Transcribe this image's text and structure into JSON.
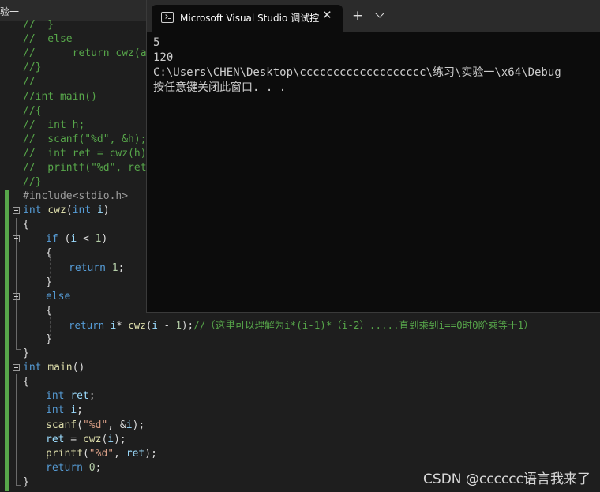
{
  "editor": {
    "tab_label": "验一",
    "code": {
      "c_if_close": "//  }",
      "c_else": "//  else",
      "c_return": "//      return cwz(a",
      "c_brace_close": "//}",
      "c_blank": "//",
      "c_main": "//int main()",
      "c_brace_open": "//{",
      "c_int_h": "//  int h;",
      "c_scanf": "//  scanf(\"%d\", &h);",
      "c_int_ret": "//  int ret = cwz(h);",
      "c_printf": "//  printf(\"%d\", ret)",
      "c_end": "//}",
      "include": "#include<stdio.h>",
      "kw_int": "int",
      "kw_if": "if",
      "kw_else": "else",
      "kw_return": "return",
      "fn_cwz": "cwz",
      "fn_main": "main",
      "fn_scanf": "scanf",
      "fn_printf": "printf",
      "var_i": "i",
      "var_ret": "ret",
      "num_0": "0",
      "num_1": "1",
      "str_fmt": "\"%d\"",
      "l14_paren": "(",
      "l14_close": ")",
      "brace_open": "{",
      "brace_close": "}",
      "l16_open": " (",
      "l16_op": " < ",
      "l16_close": ")",
      "semi": ";",
      "sp": " ",
      "l22_mid": "* ",
      "l22_paren": "(",
      "l22_op": " - ",
      "l22_close": ");",
      "l22_comment": "//（这里可以理解为i*(i-1)*（i-2）.....直到乘到i==0时0阶乘等于1）",
      "main_parens": "()",
      "l28_semi": ";",
      "l30_open": "(",
      "l30_mid": ", &",
      "l30_close": ");",
      "l31_assign": " = ",
      "l31_open": "(",
      "l31_close": ");",
      "l32_open": "(",
      "l32_comma": ", ",
      "l32_close": ");"
    }
  },
  "terminal": {
    "tab_title": "Microsoft Visual Studio 调试控",
    "close_glyph": "✕",
    "new_tab_glyph": "+",
    "output": [
      "5",
      "120",
      "C:\\Users\\CHEN\\Desktop\\ccccccccccccccccccc\\练习\\实验一\\x64\\Debug",
      "按任意键关闭此窗口. . ."
    ]
  },
  "watermark": "CSDN @cccccc语言我来了",
  "colors": {
    "editor_bg": "#1e1e1e",
    "terminal_bg": "#0c0c0c",
    "keyword": "#569cd6",
    "comment": "#57a64a",
    "string": "#d69d85",
    "number": "#b5cea8",
    "function": "#dcdcaa",
    "variable": "#9cdcfe"
  },
  "icons": [
    "terminal-app-icon",
    "close-icon",
    "plus-icon",
    "chevron-down-icon",
    "fold-toggle-icon"
  ]
}
